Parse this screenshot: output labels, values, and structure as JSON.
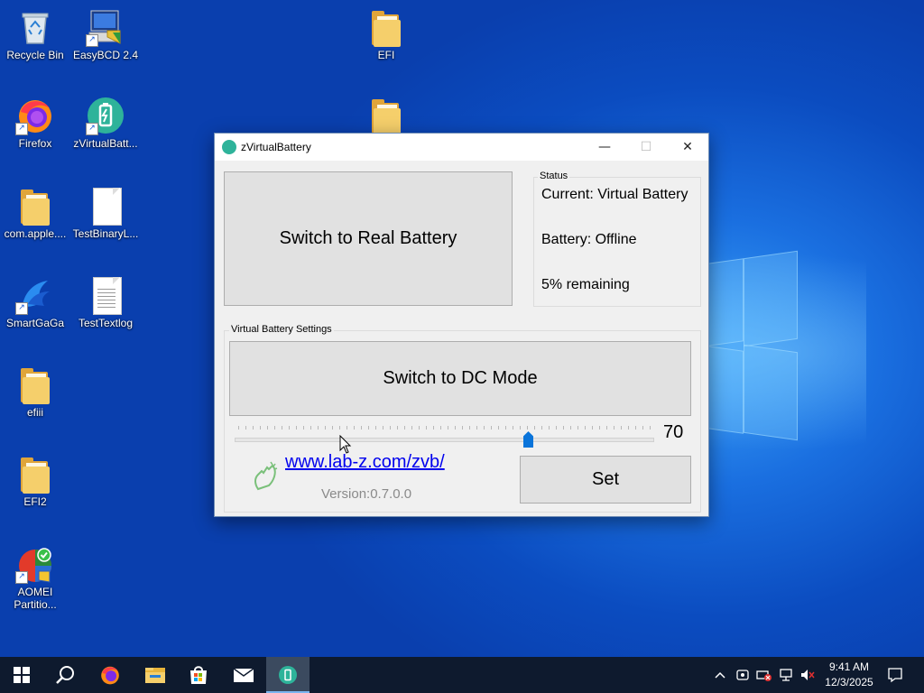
{
  "desktop": {
    "icons": [
      {
        "label": "Recycle Bin"
      },
      {
        "label": "EasyBCD 2.4"
      },
      {
        "label": "EFI"
      },
      {
        "label": "Firefox"
      },
      {
        "label": "zVirtualBatt..."
      },
      {
        "label": "com.apple...."
      },
      {
        "label": "TestBinaryL..."
      },
      {
        "label": "SmartGaGa"
      },
      {
        "label": "TestTextlog"
      },
      {
        "label": "efiii"
      },
      {
        "label": "EFI2"
      },
      {
        "label": "AOMEI Partitio..."
      }
    ]
  },
  "app": {
    "title": "zVirtualBattery",
    "titlebar": {
      "minimize": "—",
      "maximize": "☐",
      "close": "✕"
    },
    "real_battery_button": "Switch to Real Battery",
    "status": {
      "group_title": "Status",
      "current": "Current: Virtual Battery",
      "battery": "Battery: Offline",
      "remaining": "5% remaining"
    },
    "settings": {
      "group_title": "Virtual Battery Settings",
      "dc_mode_button": "Switch to DC Mode",
      "slider_value": "70",
      "slider_fraction": 0.7,
      "link": "www.lab-z.com/zvb/",
      "version": "Version:0.7.0.0",
      "set_button": "Set"
    }
  },
  "taskbar": {
    "clock_time": "9:41 AM",
    "clock_date": "12/3/2025"
  }
}
